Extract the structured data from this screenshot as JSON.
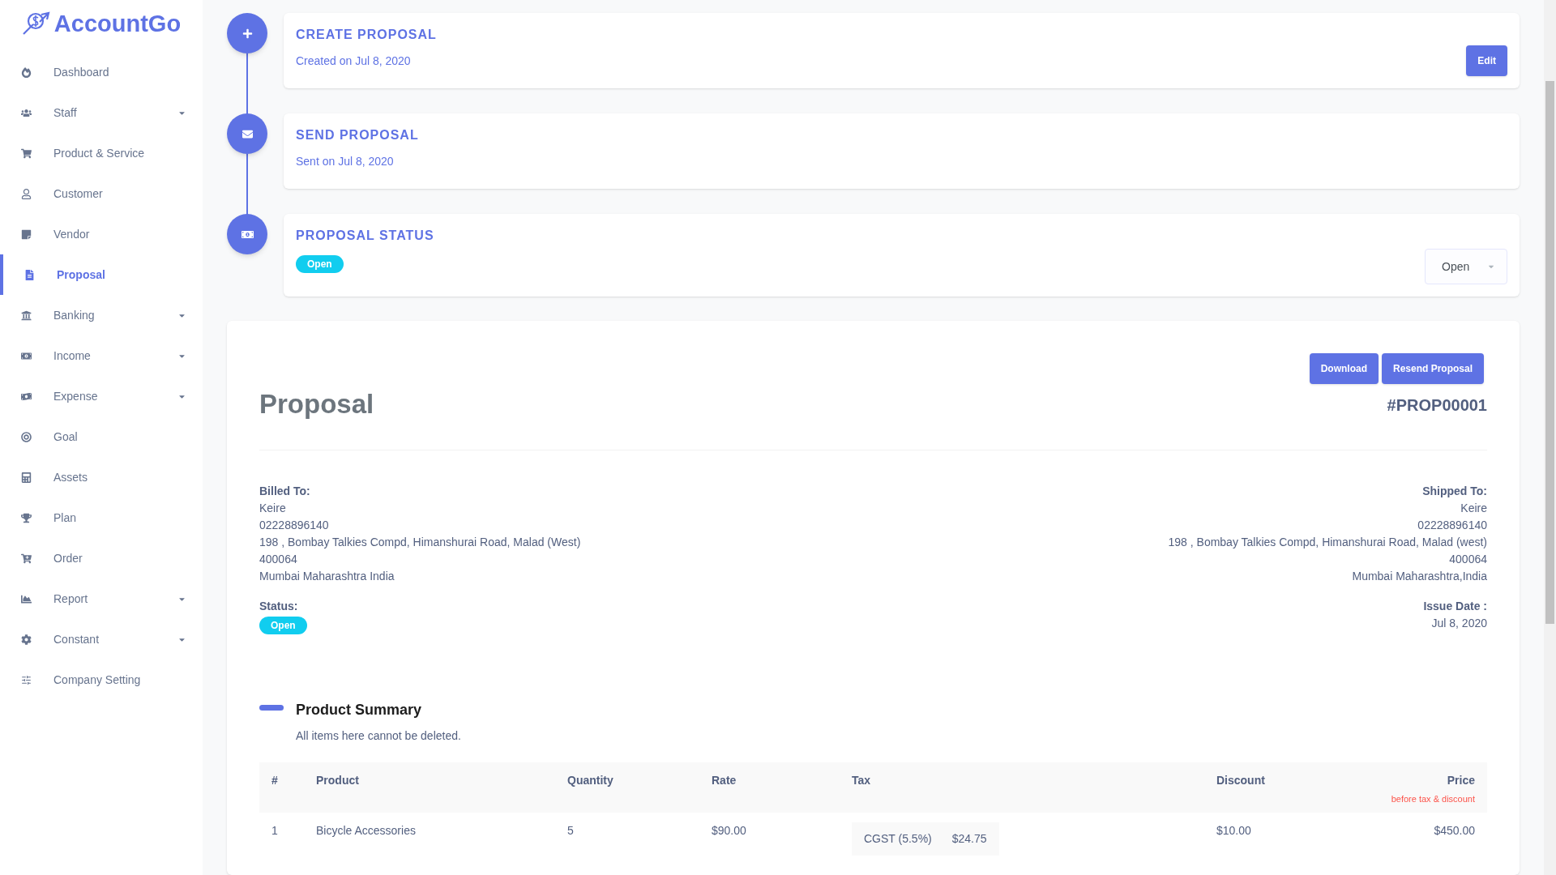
{
  "sidebar": {
    "logo": "AccountGo",
    "items": [
      {
        "label": "Dashboard",
        "selected": false,
        "has_submenu": false
      },
      {
        "label": "Staff",
        "selected": false,
        "has_submenu": true
      },
      {
        "label": "Product & Service",
        "selected": false,
        "has_submenu": false
      },
      {
        "label": "Customer",
        "selected": false,
        "has_submenu": false
      },
      {
        "label": "Vendor",
        "selected": false,
        "has_submenu": false
      },
      {
        "label": "Proposal",
        "selected": true,
        "has_submenu": false
      },
      {
        "label": "Banking",
        "selected": false,
        "has_submenu": true
      },
      {
        "label": "Income",
        "selected": false,
        "has_submenu": true
      },
      {
        "label": "Expense",
        "selected": false,
        "has_submenu": true
      },
      {
        "label": "Goal",
        "selected": false,
        "has_submenu": false
      },
      {
        "label": "Assets",
        "selected": false,
        "has_submenu": false
      },
      {
        "label": "Plan",
        "selected": false,
        "has_submenu": false
      },
      {
        "label": "Order",
        "selected": false,
        "has_submenu": false
      },
      {
        "label": "Report",
        "selected": false,
        "has_submenu": true
      },
      {
        "label": "Constant",
        "selected": false,
        "has_submenu": true
      },
      {
        "label": "Company Setting",
        "selected": false,
        "has_submenu": false
      }
    ]
  },
  "timeline": [
    {
      "kind": "create",
      "title": "CREATE PROPOSAL",
      "subtitle": "Created on Jul 8, 2020",
      "button": "Edit"
    },
    {
      "kind": "send",
      "title": "SEND PROPOSAL",
      "subtitle": "Sent on Jul 8, 2020"
    },
    {
      "kind": "status",
      "title": "PROPOSAL STATUS",
      "badge": "Open",
      "select_value": "Open"
    }
  ],
  "proposal": {
    "buttons": [
      "Download",
      "Resend Proposal"
    ],
    "title": "Proposal",
    "number": "#PROP00001",
    "billed_to": {
      "label": "Billed To:",
      "lines": [
        "Keire",
        "02228896140",
        "198 , Bombay Talkies Compd, Himanshurai Road, Malad (West)",
        "400064",
        "Mumbai Maharashtra India"
      ]
    },
    "shipped_to": {
      "label": "Shipped To:",
      "lines": [
        "Keire",
        "02228896140",
        "198 , Bombay Talkies Compd, Himanshurai Road, Malad (west)",
        "400064",
        "Mumbai Maharashtra,India"
      ]
    },
    "status": {
      "label": "Status:",
      "badge": "Open"
    },
    "issue_date": {
      "label": "Issue Date :",
      "value": "Jul 8, 2020"
    },
    "summary": {
      "title": "Product Summary",
      "note": "All items here cannot be deleted."
    },
    "table": {
      "columns": [
        "#",
        "Product",
        "Quantity",
        "Rate",
        "Tax",
        "Discount",
        "Price"
      ],
      "price_note": "before tax & discount",
      "rows": [
        {
          "number": "1",
          "product": "Bicycle Accessories",
          "quantity": "5",
          "rate": "$90.00",
          "taxes": [
            {
              "name": "CGST (5.5%)",
              "amount": "$24.75"
            }
          ],
          "discount": "$10.00",
          "price": "$450.00"
        }
      ]
    }
  }
}
